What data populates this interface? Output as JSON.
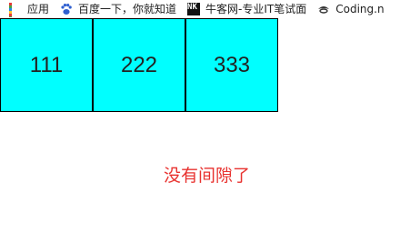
{
  "bookmarks_bar": {
    "items": [
      {
        "label": "应用",
        "icon": "apps-grid-icon"
      },
      {
        "label": "百度一下，你就知道",
        "icon": "baidu-paw-icon"
      },
      {
        "label": "牛客网-专业IT笔试面",
        "icon": "nowcoder-icon",
        "icon_text": "NK"
      },
      {
        "label": "Coding.n",
        "icon": "coding-hat-icon"
      }
    ]
  },
  "boxes": [
    {
      "value": "111"
    },
    {
      "value": "222"
    },
    {
      "value": "333"
    }
  ],
  "note": "没有间隙了",
  "colors": {
    "box_fill": "#00ffff",
    "note_text": "#e8322f"
  }
}
